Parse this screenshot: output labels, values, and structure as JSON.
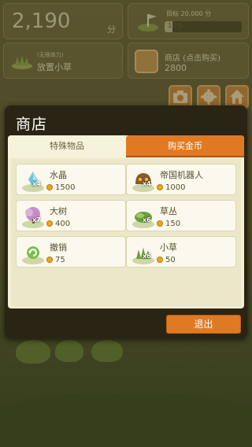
{
  "hud": {
    "score_value": "2,190",
    "score_unit": "分",
    "goal_label": "目标 20,000 分",
    "goal_percent": "10%",
    "goal_progress": 0.1,
    "stamina_sub": "(无限体力)",
    "stamina_main": "放置小草",
    "shop_main": "商店 (点击购买)",
    "shop_price": "2800"
  },
  "dialog": {
    "title": "商店",
    "tabs": [
      {
        "label": "特殊物品",
        "active": false
      },
      {
        "label": "购买金币",
        "active": true
      }
    ],
    "items": [
      {
        "name": "水晶",
        "price": "1500",
        "qty": "x4",
        "icon": "crystal-icon"
      },
      {
        "name": "帝国机器人",
        "price": "1000",
        "qty": "x4",
        "icon": "robot-icon"
      },
      {
        "name": "大树",
        "price": "400",
        "qty": "x7",
        "icon": "tree-icon"
      },
      {
        "name": "草丛",
        "price": "150",
        "qty": "x6",
        "icon": "bush-icon"
      },
      {
        "name": "撤销",
        "price": "75",
        "qty": "",
        "icon": "undo-icon"
      },
      {
        "name": "小草",
        "price": "50",
        "qty": "x6",
        "icon": "grass-icon"
      }
    ],
    "exit_label": "退出"
  },
  "colors": {
    "accent": "#e07a22",
    "coin": "#e9a621",
    "dialog_bg": "#2a2414",
    "content_bg": "#f3efd3"
  }
}
